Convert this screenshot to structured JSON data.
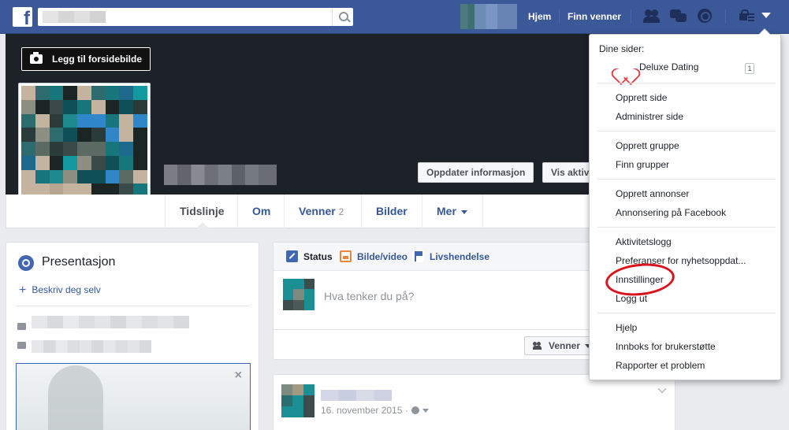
{
  "topbar": {
    "logo": "f",
    "nav": {
      "home": "Hjem",
      "find_friends": "Finn venner"
    },
    "icons": [
      "friends-icon",
      "messages-icon",
      "notifications-globe-icon",
      "privacy-lock-icon",
      "account-menu-caret-icon"
    ]
  },
  "cover": {
    "add_cover_label": "Legg til forsidebilde",
    "update_info_label": "Oppdater informasjon",
    "view_activity_label": "Vis aktivitetslogg"
  },
  "tabs": [
    {
      "label": "Tidslinje"
    },
    {
      "label": "Om"
    },
    {
      "label": "Venner",
      "count": "2"
    },
    {
      "label": "Bilder"
    },
    {
      "label": "Mer"
    }
  ],
  "intro": {
    "title": "Presentasjon",
    "describe_link": "Beskriv deg selv",
    "close_glyph": "×"
  },
  "composer": {
    "tabs": {
      "status": "Status",
      "photo": "Bilde/video",
      "life": "Livshendelse"
    },
    "placeholder": "Hva tenker du på?",
    "audience": "Venner"
  },
  "post": {
    "date": "16. november 2015 ·"
  },
  "menu": {
    "header": "Dine sider:",
    "page": {
      "name": "Deluxe Dating",
      "badge": "1"
    },
    "groups": [
      [
        "Opprett side",
        "Administrer side"
      ],
      [
        "Opprett gruppe",
        "Finn grupper"
      ],
      [
        "Opprett annonser",
        "Annonsering på Facebook"
      ],
      [
        "Aktivitetslogg",
        "Preferanser for nyhetsoppdat...",
        "Innstillinger",
        "Logg ut"
      ],
      [
        "Hjelp",
        "Innboks for brukerstøtte",
        "Rapporter et problem"
      ]
    ]
  },
  "colors": {
    "brand": "#3b5998",
    "link": "#365899",
    "highlight_ring": "#d9121b"
  }
}
